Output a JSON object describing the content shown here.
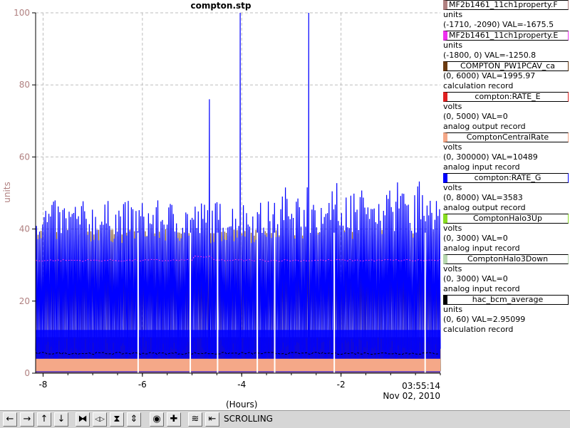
{
  "window": {
    "title": "compton.stp"
  },
  "chart_data": {
    "type": "line",
    "title": "compton.stp",
    "ylabel": "units",
    "xlabel": "(Hours)",
    "xlim": [
      -8.15,
      0
    ],
    "ylim": [
      0,
      100
    ],
    "yticks": [
      "0",
      "20",
      "40",
      "60",
      "80",
      "100"
    ],
    "xticks": [
      "-8",
      "-6",
      "-4",
      "-2"
    ],
    "time_label": "03:55:14",
    "date_label": "Nov 02, 2010",
    "grid": true,
    "series": [
      {
        "name": "MF2b1461_11ch1property.F",
        "color": "#b08080",
        "approx_level": 0
      },
      {
        "name": "MF2b1461_11ch1property.E",
        "color": "#ee30ee",
        "approx_level": 31
      },
      {
        "name": "COMPTON_PW1PCAV_ca",
        "color": "#6b3a10",
        "approx_level": 33
      },
      {
        "name": "compton:RATE_E",
        "color": "#e02020",
        "approx_level": 0
      },
      {
        "name": "ComptonCentralRate",
        "color": "#f5a888",
        "approx_level": 3.5
      },
      {
        "name": "compton:RATE_G",
        "color": "#0000ff",
        "approx_level": 42,
        "spikes": [
          [
            -4.65,
            76
          ],
          [
            -4.03,
            100
          ],
          [
            -2.65,
            100
          ]
        ]
      },
      {
        "name": "ComptonHalo3Up",
        "color": "#88dd22",
        "approx_level": 0
      },
      {
        "name": "ComptonHalo3Down",
        "color": "#b8d8b0",
        "approx_level": 0
      },
      {
        "name": "hac_bcm_average",
        "color": "#000000",
        "approx_level": 5.5
      }
    ]
  },
  "legend": [
    {
      "name": "MF2b1461_11ch1property.F",
      "color": "#b08080",
      "align": "left",
      "lines": [
        "units",
        "(-1710, -2090) VAL=-1675.5"
      ]
    },
    {
      "name": "MF2b1461_11ch1property.E",
      "color": "#ee30ee",
      "align": "left",
      "lines": [
        "units",
        "(-1800, 0) VAL=-1250.8"
      ]
    },
    {
      "name": "COMPTON_PW1PCAV_ca",
      "color": "#6b3a10",
      "align": "center",
      "lines": [
        "(0, 6000) VAL=1995.97",
        "calculation record"
      ]
    },
    {
      "name": "compton:RATE_E",
      "color": "#e02020",
      "align": "center",
      "lines": [
        "volts",
        "(0, 5000) VAL=0",
        "analog output record"
      ]
    },
    {
      "name": "ComptonCentralRate",
      "color": "#f5a888",
      "align": "center",
      "lines": [
        "volts",
        "(0, 300000) VAL=10489",
        "analog input record"
      ]
    },
    {
      "name": "compton:RATE_G",
      "color": "#0000ff",
      "align": "center",
      "lines": [
        "volts",
        "(0, 8000) VAL=3583",
        "analog output record"
      ]
    },
    {
      "name": "ComptonHalo3Up",
      "color": "#88dd22",
      "align": "center",
      "lines": [
        "volts",
        "(0, 3000) VAL=0",
        "analog input record"
      ]
    },
    {
      "name": "ComptonHalo3Down",
      "color": "#b8d8b0",
      "align": "center",
      "lines": [
        "volts",
        "(0, 3000) VAL=0",
        "analog input record"
      ]
    },
    {
      "name": "hac_bcm_average",
      "color": "#000000",
      "align": "center",
      "lines": [
        "units",
        "(0, 60) VAL=2.95099",
        "calculation record"
      ]
    }
  ],
  "toolbar": {
    "buttons": [
      {
        "name": "pan-left-button",
        "glyph": "←"
      },
      {
        "name": "pan-right-button",
        "glyph": "→"
      },
      {
        "name": "pan-up-button",
        "glyph": "↑"
      },
      {
        "name": "pan-down-button",
        "glyph": "↓"
      },
      {
        "name": "zoom-in-x-button",
        "glyph": "⧓"
      },
      {
        "name": "zoom-out-x-button",
        "glyph": "◁▷"
      },
      {
        "name": "zoom-in-y-button",
        "glyph": "⧗"
      },
      {
        "name": "zoom-out-y-button",
        "glyph": "⇕"
      },
      {
        "name": "autoscale-button",
        "glyph": "◉"
      },
      {
        "name": "reset-button",
        "glyph": "✚"
      },
      {
        "name": "config-button",
        "glyph": "≋"
      },
      {
        "name": "mode-toggle-button",
        "glyph": "⇤"
      }
    ],
    "status": "SCROLLING"
  }
}
